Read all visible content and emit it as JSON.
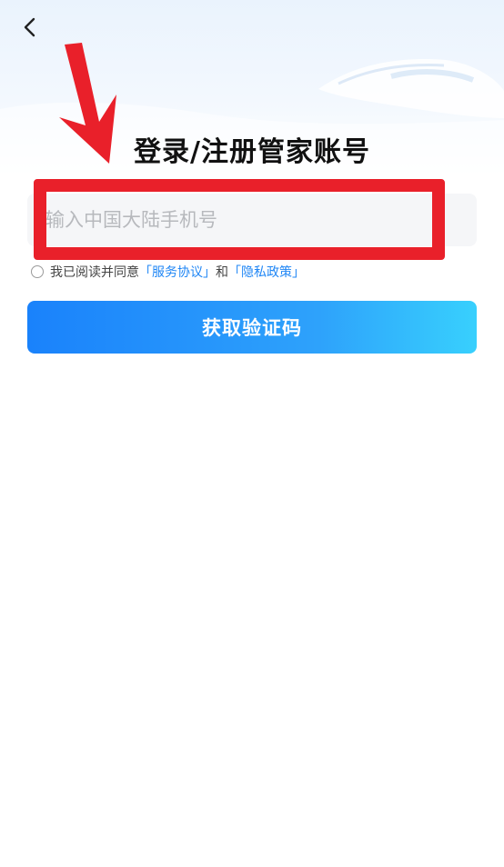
{
  "header": {
    "back_icon": "chevron-left-icon"
  },
  "page": {
    "title": "登录/注册管家账号"
  },
  "phone": {
    "placeholder": "输入中国大陆手机号",
    "value": ""
  },
  "agreement": {
    "prefix": "我已阅读并同意",
    "terms_link": "「服务协议」",
    "conjunction": "和",
    "privacy_link": "「隐私政策」",
    "checked": false
  },
  "actions": {
    "get_code_label": "获取验证码"
  },
  "colors": {
    "accent": "#1f86f5",
    "annotation": "#e9202a",
    "button_start": "#1a82fb",
    "button_end": "#38d0fd"
  }
}
